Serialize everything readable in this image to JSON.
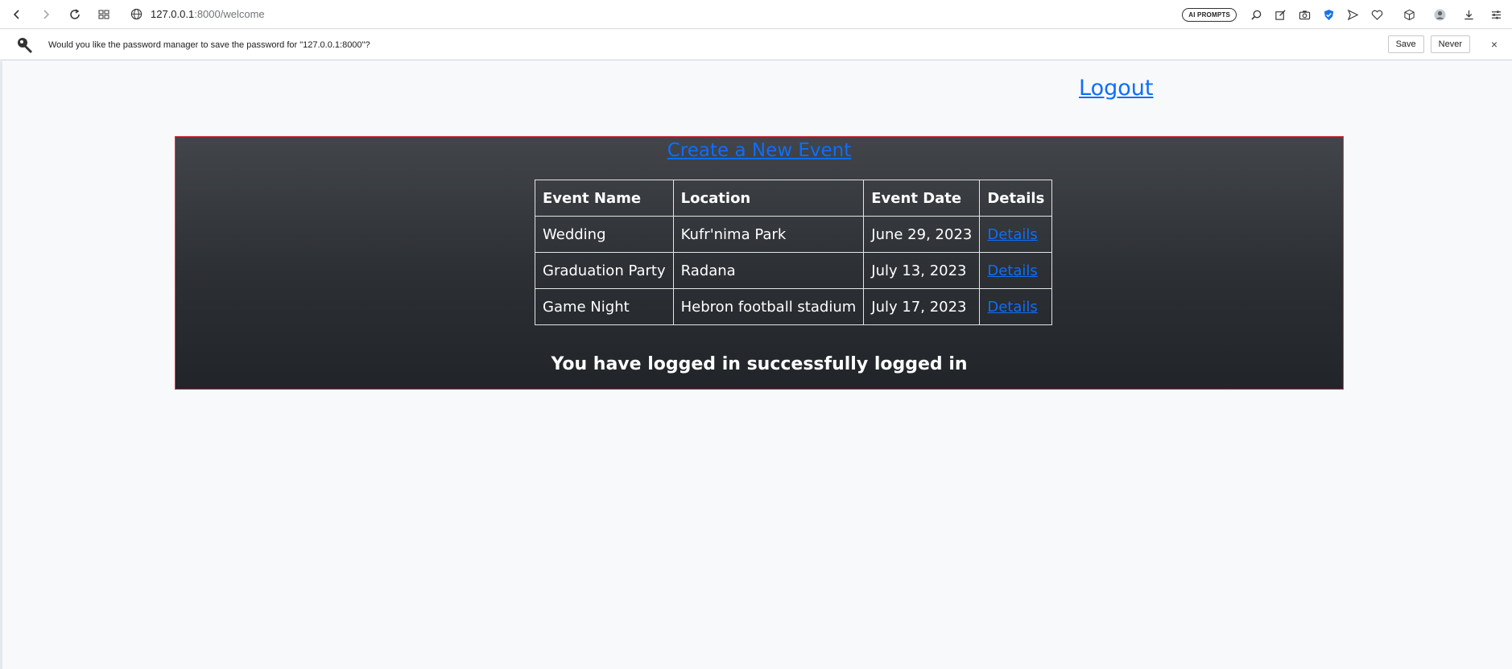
{
  "browser": {
    "url_host": "127.0.0.1",
    "url_path": ":8000/welcome",
    "ai_prompts_label": "AI PROMPTS"
  },
  "password_bar": {
    "message": "Would you like the password manager to save the password for \"127.0.0.1:8000\"?",
    "save_label": "Save",
    "never_label": "Never",
    "close_label": "×"
  },
  "page": {
    "logout_label": "Logout",
    "create_event_label": "Create a New Event",
    "table": {
      "headers": [
        "Event Name",
        "Location",
        "Event Date",
        "Details"
      ],
      "rows": [
        {
          "name": "Wedding",
          "location": "Kufr'nima Park",
          "date": "June 29, 2023",
          "details": "Details"
        },
        {
          "name": "Graduation Party",
          "location": "Radana",
          "date": "July 13, 2023",
          "details": "Details"
        },
        {
          "name": "Game Night",
          "location": "Hebron football stadium",
          "date": "July 17, 2023",
          "details": "Details"
        }
      ]
    },
    "success_message": "You have logged in successfully logged in"
  },
  "colors": {
    "link": "#0d6efd",
    "panel_border": "#dc3545",
    "panel_bg_top": "#42454a",
    "panel_bg_bottom": "#212529"
  }
}
